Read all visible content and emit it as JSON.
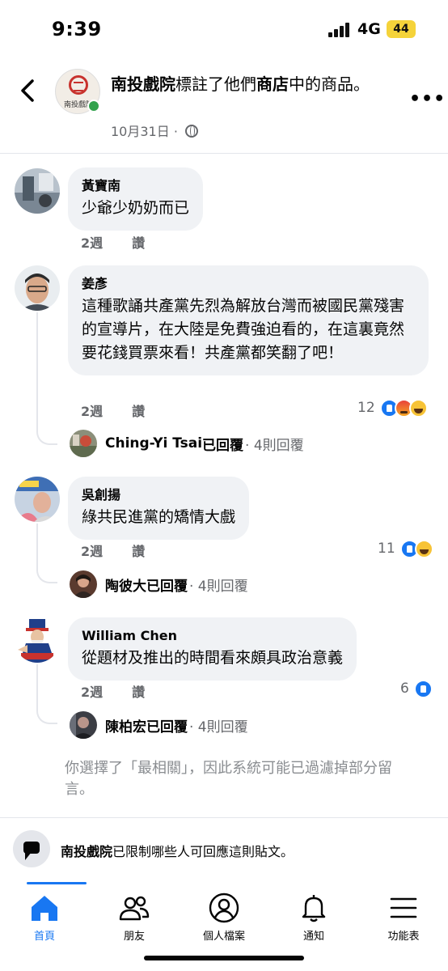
{
  "status": {
    "time": "9:39",
    "network": "4G",
    "battery": "44"
  },
  "header": {
    "page_name": "南投戲院",
    "title_mid": "標註了他們",
    "title_store": "商店",
    "title_end": "中的商品。",
    "date": "10月31日",
    "dot": "·",
    "logo_text": "南投戲院",
    "icons": {
      "back": "chevron-left-icon",
      "more": "more-dots-icon",
      "privacy": "globe-icon"
    }
  },
  "comments": [
    {
      "name": "黃寶南",
      "text": "少爺少奶奶而已",
      "time": "2週",
      "like": "讚"
    },
    {
      "name": "姜彥",
      "text": "這種歌誦共產黨先烈為解放台灣而被國民黨殘害的宣導片，在大陸是免費強迫看的，在這裏竟然要花錢買票來看！共產黨都笑翻了吧！",
      "time": "2週",
      "like": "讚",
      "reaction_count": "12",
      "reply": {
        "name": "Ching-Yi Tsai",
        "replied": "已回覆",
        "count": "· 4則回覆"
      }
    },
    {
      "name": "吳創揚",
      "text": "綠共民進黨的矯情大戲",
      "time": "2週",
      "like": "讚",
      "reaction_count": "11",
      "reply": {
        "name": "陶彼大",
        "replied": "已回覆",
        "count": "· 4則回覆"
      }
    },
    {
      "name": "William Chen",
      "text": "從題材及推出的時間看來頗具政治意義",
      "time": "2週",
      "like": "讚",
      "reaction_count": "6",
      "reply": {
        "name": "陳柏宏",
        "replied": "已回覆",
        "count": "· 4則回覆"
      }
    }
  ],
  "filter_note": "你選擇了「最相關」，因此系統可能已過濾掉部分留言。",
  "restrict": {
    "page_name": "南投戲院",
    "text": "已限制哪些人可回應這則貼文。"
  },
  "tabs": [
    {
      "label": "首頁",
      "icon": "home-icon"
    },
    {
      "label": "朋友",
      "icon": "friends-icon"
    },
    {
      "label": "個人檔案",
      "icon": "profile-icon"
    },
    {
      "label": "通知",
      "icon": "bell-icon"
    },
    {
      "label": "功能表",
      "icon": "menu-icon"
    }
  ],
  "colors": {
    "accent": "#1877f2",
    "bubble": "#f0f2f5",
    "secondary_text": "#65676b"
  }
}
